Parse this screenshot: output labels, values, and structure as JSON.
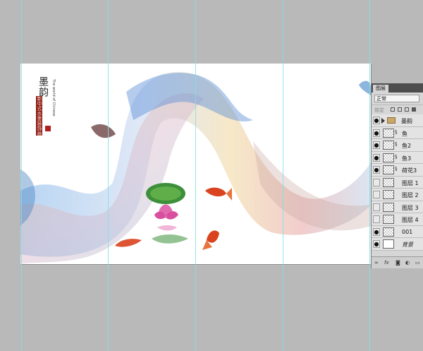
{
  "artwork": {
    "title": "墨韵",
    "subtitle": "The world of Chinese",
    "seal_text": "新中式水墨装饰画"
  },
  "layers_panel": {
    "tab_label": "图层",
    "blend_mode": "正常",
    "lock_label": "锁定",
    "layers": [
      {
        "name": "墨韵",
        "kind": "group",
        "visible": true
      },
      {
        "name": "鱼",
        "kind": "linked",
        "visible": true
      },
      {
        "name": "鱼2",
        "kind": "linked",
        "visible": true
      },
      {
        "name": "鱼3",
        "kind": "linked",
        "visible": true
      },
      {
        "name": "荷花3",
        "kind": "linked",
        "visible": true
      },
      {
        "name": "图层 1",
        "kind": "pixel",
        "visible": false
      },
      {
        "name": "图层 2",
        "kind": "pixel",
        "visible": false
      },
      {
        "name": "图层 3",
        "kind": "pixel",
        "visible": false
      },
      {
        "name": "图层 4",
        "kind": "pixel",
        "visible": false
      },
      {
        "name": "001",
        "kind": "pixel",
        "visible": true
      },
      {
        "name": "背景",
        "kind": "background",
        "visible": true
      }
    ],
    "footer_icons": [
      "link-icon",
      "fx-icon",
      "mask-icon",
      "adjustment-icon",
      "new-layer-icon"
    ]
  },
  "colors": {
    "workspace": "#b9b9b9",
    "guide": "#7fe0e6",
    "panel": "#d6d6d6"
  }
}
